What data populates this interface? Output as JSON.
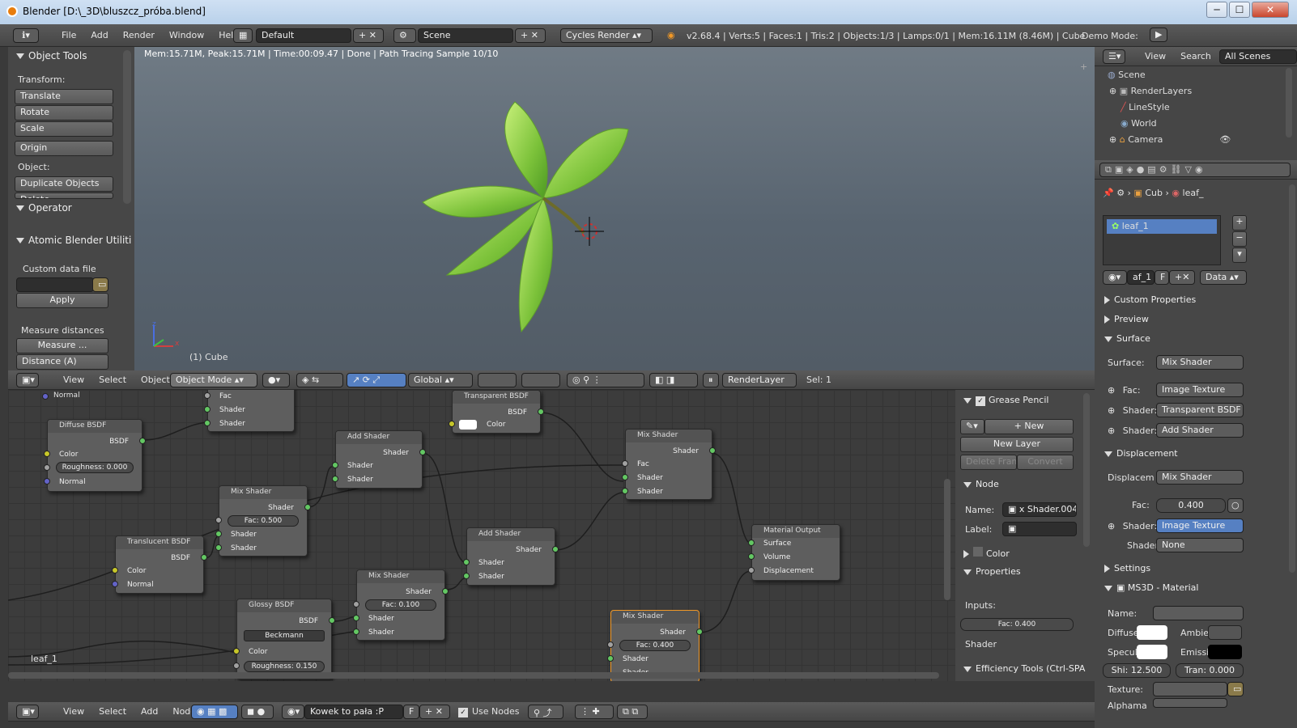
{
  "window": {
    "title": "Blender [D:\\_3D\\bluszcz_próba.blend]",
    "min": "─",
    "max": "☐",
    "close": "✕"
  },
  "topmenu": {
    "items": [
      "File",
      "Add",
      "Render",
      "Window",
      "Help"
    ],
    "layout": "Default",
    "scene": "Scene",
    "engine": "Cycles Render",
    "stats": "v2.68.4 | Verts:5 | Faces:1 | Tris:2 | Objects:1/3 | Lamps:0/1 | Mem:16.11M (8.46M) | Cube",
    "demo": "Demo Mode:"
  },
  "tools": {
    "title": "Object Tools",
    "transform": "Transform:",
    "translate": "Translate",
    "rotate": "Rotate",
    "scale": "Scale",
    "origin": "Origin",
    "object": "Object:",
    "duplicate": "Duplicate Objects",
    "delete": "Delete",
    "operator": "Operator",
    "atomic": "Atomic Blender Utiliti",
    "custom": "Custom data file",
    "apply": "Apply",
    "measure_title": "Measure distances",
    "measure": "Measure ...",
    "distance": "Distance (A)"
  },
  "viewport": {
    "status": "Mem:15.71M, Peak:15.71M | Time:00:09.47 | Done | Path Tracing Sample 10/10",
    "object_label": "(1) Cube",
    "axis_x": "x",
    "axis_z": "z"
  },
  "viewheader": {
    "menus": [
      "View",
      "Select",
      "Object"
    ],
    "mode": "Object Mode",
    "orientation": "Global",
    "renderlayer": "RenderLayer",
    "sel": "Sel: 1"
  },
  "outliner": {
    "menus": [
      "View",
      "Search"
    ],
    "filter": "All Scenes",
    "items": [
      "Scene",
      "RenderLayers",
      "LineStyle",
      "World",
      "Camera"
    ]
  },
  "props": {
    "breadcrumb_obj": "Cub",
    "breadcrumb_mat": "leaf_",
    "material": "leaf_1",
    "mat_field": "af_1",
    "mat_f": "F",
    "data": "Data",
    "sections": {
      "custom": "Custom Properties",
      "preview": "Preview",
      "surface": "Surface",
      "displacement": "Displacement",
      "settings": "Settings",
      "ms3d": "MS3D - Material"
    },
    "surface_label": "Surface:",
    "surface_val": "Mix Shader",
    "fac_label": "Fac:",
    "fac_val": "Image Texture",
    "shader1_label": "Shader:",
    "shader1_val": "Transparent BSDF",
    "shader2_label": "Shader:",
    "shader2_val": "Add Shader",
    "disp_label": "Displacem",
    "disp_val": "Mix Shader",
    "dfac_label": "Fac:",
    "dfac_val": "0.400",
    "dshader1_label": "Shader:",
    "dshader1_val": "Image Texture",
    "dshader2_label": "Shader:",
    "dshader2_val": "None",
    "ms_name": "Name:",
    "ms_diffuse": "Diffuse",
    "ms_ambient": "Ambie",
    "ms_specular": "Specul",
    "ms_emissive": "Emissi",
    "ms_shi": "Shi: 12.500",
    "ms_tran": "Tran: 0.000",
    "ms_texture": "Texture:",
    "ms_alpha": "Alphama"
  },
  "npanel": {
    "grease": "Grease Pencil",
    "new": "New",
    "new_layer": "New Layer",
    "delete_frame": "Delete Frame",
    "convert": "Convert",
    "node": "Node",
    "name_label": "Name:",
    "name_val": "x Shader.004",
    "label_label": "Label:",
    "color": "Color",
    "properties": "Properties",
    "inputs": "Inputs:",
    "fac": "Fac: 0.400",
    "shader": "Shader",
    "efficiency": "Efficiency Tools (Ctrl-SPA"
  },
  "nodes": {
    "normal_top": "Normal",
    "diffuse": {
      "title": "Diffuse BSDF",
      "out": "BSDF",
      "color": "Color",
      "rough": "Roughness: 0.000",
      "normal": "Normal"
    },
    "mix_top": {
      "fac": "Fac",
      "s1": "Shader",
      "s2": "Shader"
    },
    "transparent": {
      "title": "Transparent BSDF",
      "out": "BSDF",
      "color": "Color"
    },
    "add1": {
      "title": "Add Shader",
      "out": "Shader",
      "s1": "Shader",
      "s2": "Shader"
    },
    "mix1": {
      "title": "Mix Shader",
      "out": "Shader",
      "fac": "Fac: 0.500",
      "s1": "Shader",
      "s2": "Shader"
    },
    "mix_right": {
      "title": "Mix Shader",
      "out": "Shader",
      "fac": "Fac",
      "s1": "Shader",
      "s2": "Shader"
    },
    "translucent": {
      "title": "Translucent BSDF",
      "out": "BSDF",
      "color": "Color",
      "normal": "Normal"
    },
    "add2": {
      "title": "Add Shader",
      "out": "Shader",
      "s1": "Shader",
      "s2": "Shader"
    },
    "mix2": {
      "title": "Mix Shader",
      "out": "Shader",
      "fac": "Fac: 0.100",
      "s1": "Shader",
      "s2": "Shader"
    },
    "output": {
      "title": "Material Output",
      "surface": "Surface",
      "volume": "Volume",
      "disp": "Displacement"
    },
    "glossy": {
      "title": "Glossy BSDF",
      "out": "BSDF",
      "dist": "Beckmann",
      "color": "Color",
      "rough": "Roughness: 0.150"
    },
    "mix3": {
      "title": "Mix Shader",
      "out": "Shader",
      "fac": "Fac: 0.400",
      "s1": "Shader",
      "s2": "Shader"
    },
    "leaf_label": "leaf_1"
  },
  "nodeheader": {
    "menus": [
      "View",
      "Select",
      "Add",
      "Node"
    ],
    "material": "Kowek to pała :P",
    "f": "F",
    "use_nodes": "Use Nodes"
  }
}
